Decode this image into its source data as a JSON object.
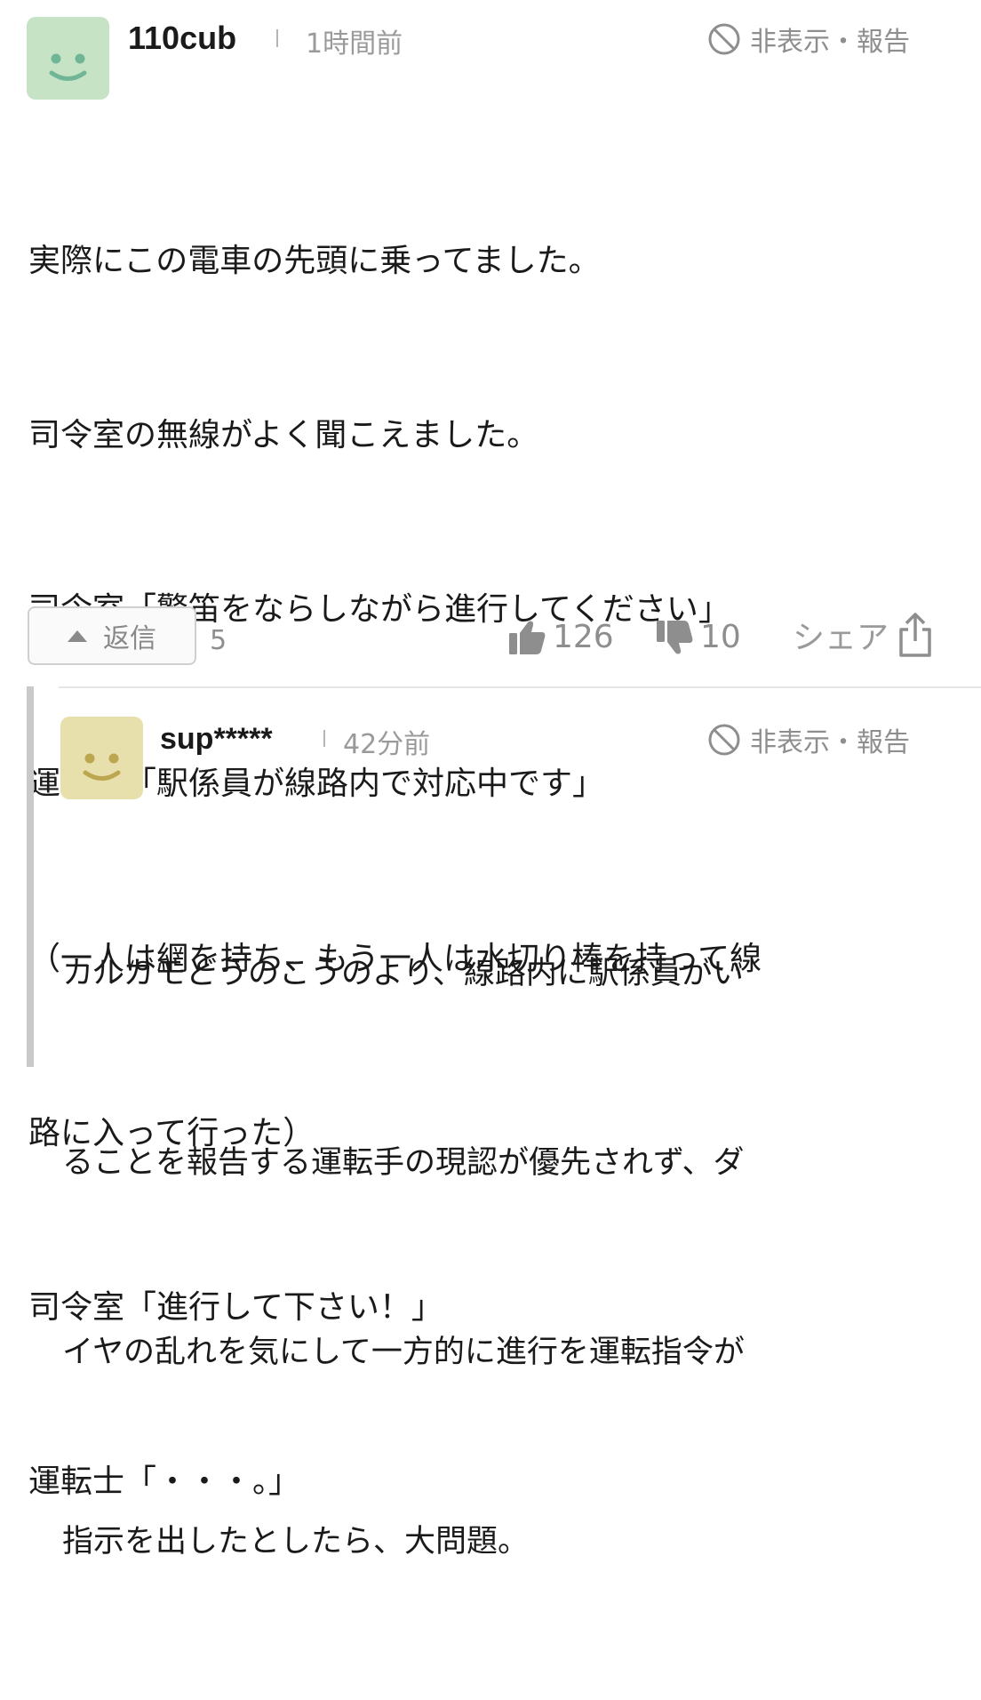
{
  "comment": {
    "avatar_icon": "smiley-face-icon",
    "avatar_bg": "#c6e3c6",
    "avatar_fg": "#6fb596",
    "username": "110cub",
    "time": "1時間前",
    "hide_report_icon": "prohibited-icon",
    "hide_report_label": "非表示・報告",
    "lines": [
      "実際にこの電車の先頭に乗ってました。",
      "司令室の無線がよく聞こえました。",
      "司令室「警笛をならしながら進行してください」",
      "運転士「駅係員が線路内で対応中です」",
      "（一人は網を持ち、もう一人は水切り棒を持って線",
      "路に入って行った）",
      "司令室「進行して下さい！」",
      "運転士「・・・。」"
    ],
    "reply_button_label": "返信",
    "reply_count": "5",
    "like_icon": "thumbs-up-icon",
    "like_count": "126",
    "dislike_icon": "thumbs-down-icon",
    "dislike_count": "10",
    "share_label": "シェア",
    "share_icon": "share-icon"
  },
  "reply": {
    "avatar_icon": "smiley-face-icon",
    "avatar_bg": "#e8e0ac",
    "avatar_fg": "#bda650",
    "username": "sup*****",
    "time": "42分前",
    "hide_report_icon": "prohibited-icon",
    "hide_report_label": "非表示・報告",
    "lines": [
      "カルガモどうのこうのより、線路内に駅係員がい",
      "ることを報告する運転手の現認が優先されず、ダ",
      "イヤの乱れを気にして一方的に進行を運転指令が",
      "指示を出したとしたら、大問題。"
    ]
  }
}
